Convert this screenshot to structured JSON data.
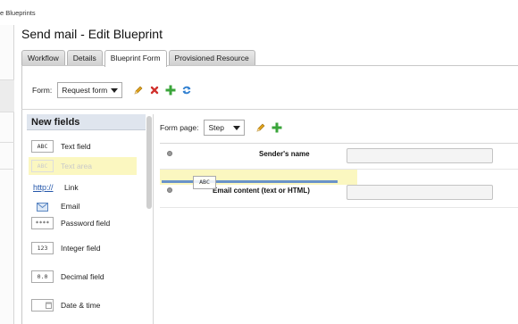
{
  "breadcrumb": "e Blueprints",
  "page_title": "Send mail - Edit Blueprint",
  "tabs": [
    {
      "label": "Workflow"
    },
    {
      "label": "Details"
    },
    {
      "label": "Blueprint Form",
      "active": true
    },
    {
      "label": "Provisioned Resource"
    }
  ],
  "form_selector": {
    "label": "Form:",
    "value": "Request form",
    "icons": [
      "edit-pencil-icon",
      "delete-x-icon",
      "add-plus-icon",
      "refresh-icon"
    ]
  },
  "new_fields": {
    "header": "New fields",
    "items": [
      {
        "label": "Text field",
        "icon_text": "ABC"
      },
      {
        "label": "Text area",
        "icon_text": "ABC",
        "highlighted": true
      },
      {
        "label": "Link",
        "icon_text": "http://"
      },
      {
        "label": "Email",
        "icon": "envelope-icon"
      },
      {
        "label": "Password field",
        "icon_text": "****"
      },
      {
        "label": "Integer field",
        "icon_text": "123"
      },
      {
        "label": "Decimal field",
        "icon_text": "0.0"
      },
      {
        "label": "Date & time",
        "icon": "calendar-icon"
      }
    ]
  },
  "form_page": {
    "label": "Form page:",
    "value": "Step",
    "icons": [
      "edit-pencil-icon",
      "add-plus-icon"
    ]
  },
  "form_fields": [
    {
      "label": "Sender's name",
      "value": ""
    },
    {
      "label": "Email content (text or HTML)",
      "value": ""
    }
  ],
  "drag_ghost": "ABC",
  "colors": {
    "accent_blue": "#6a93c9",
    "highlight_yellow": "#fbf7c0",
    "palette_header_bg": "#dfe5ee",
    "pencil": "#e0a21a",
    "delete_red": "#d0312d",
    "add_green": "#3aa53a",
    "refresh_blue": "#2f7fd0"
  }
}
